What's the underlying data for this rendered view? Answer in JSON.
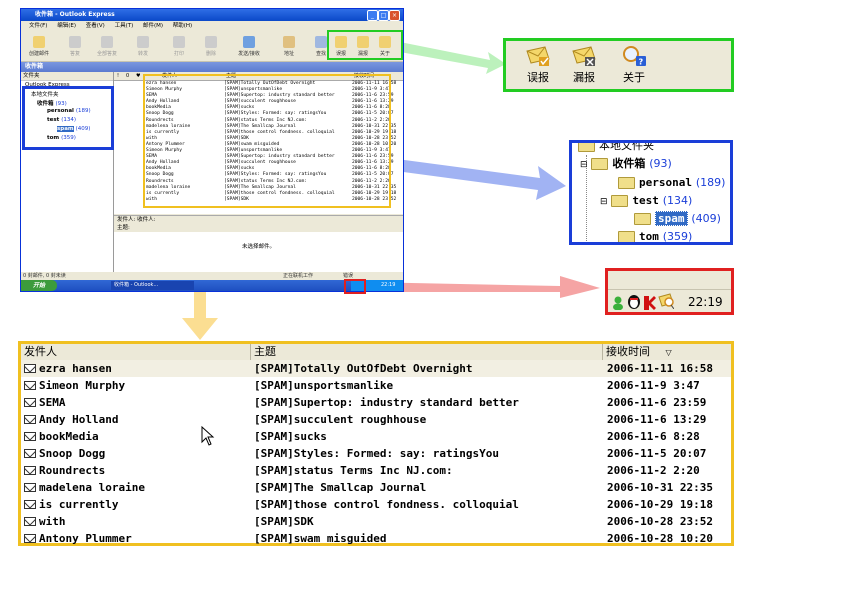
{
  "window": {
    "title": "收件箱 - Outlook Express",
    "menu": [
      "文件(F)",
      "编辑(E)",
      "查看(V)",
      "工具(T)",
      "邮件(M)",
      "帮助(H)"
    ],
    "toolbar": [
      "创建邮件",
      "答复",
      "全部答复",
      "转发",
      "打印",
      "删除",
      "发送/接收",
      "地址",
      "查找",
      "误报",
      "漏报",
      "关于"
    ],
    "folder_header": "收件箱",
    "tree_header": "文件夹",
    "tree": [
      {
        "label": "Outlook Express",
        "count": ""
      },
      {
        "label": "本地文件夹",
        "count": ""
      },
      {
        "label": "收件箱",
        "count": "(93)"
      },
      {
        "label": "personal",
        "count": "(189)"
      },
      {
        "label": "test",
        "count": "(134)"
      },
      {
        "label": "spam",
        "count": "(409)"
      },
      {
        "label": "tom",
        "count": "(359)"
      }
    ],
    "list_headers": [
      "!",
      "0",
      "♥",
      "发件人",
      "主题",
      "接收时间"
    ],
    "preview_from_label": "发件人:",
    "preview_subject_label": "主题:",
    "preview_to_label": "收件人:",
    "preview_empty": "未选择邮件。",
    "status_left": "0 封邮件, 0 封未读",
    "status_mid": "正在联机工作",
    "status_right": "错误",
    "start": "开始",
    "task": "收件箱 - Outlook...",
    "tray_time": "22:19"
  },
  "zoom_toolbar": {
    "buttons": [
      {
        "label": "误报",
        "icon": "envelope-check-icon"
      },
      {
        "label": "漏报",
        "icon": "envelope-x-icon"
      },
      {
        "label": "关于",
        "icon": "magnifier-help-icon"
      }
    ]
  },
  "zoom_tree": {
    "root": "本地文件夹",
    "items": [
      {
        "label": "收件箱",
        "count": "(93)"
      },
      {
        "label": "personal",
        "count": "(189)"
      },
      {
        "label": "test",
        "count": "(134)"
      },
      {
        "label": "spam",
        "count": "(409)"
      },
      {
        "label": "tom",
        "count": "(359)"
      }
    ]
  },
  "zoom_tray": {
    "time": "22:19"
  },
  "messages": {
    "headers": {
      "from": "发件人",
      "subject": "主题",
      "received": "接收时间"
    },
    "rows": [
      {
        "from": "ezra hansen",
        "subject": "[SPAM]Totally OutOfDebt Overnight",
        "received": "2006-11-11 16:58"
      },
      {
        "from": "Simeon Murphy",
        "subject": "[SPAM]unsportsmanlike",
        "received": "2006-11-9 3:47"
      },
      {
        "from": "SEMA",
        "subject": "[SPAM]Supertop: industry standard better",
        "received": "2006-11-6 23:59"
      },
      {
        "from": "Andy Holland",
        "subject": "[SPAM]succulent roughhouse",
        "received": "2006-11-6 13:29"
      },
      {
        "from": "bookMedia",
        "subject": "[SPAM]sucks",
        "received": "2006-11-6 8:28"
      },
      {
        "from": "Snoop Dogg",
        "subject": "[SPAM]Styles: Formed: say: ratingsYou",
        "received": "2006-11-5 20:07"
      },
      {
        "from": "Roundrects",
        "subject": "[SPAM]status Terms Inc NJ.com:",
        "received": "2006-11-2 2:20"
      },
      {
        "from": "madelena loraine",
        "subject": "[SPAM]The Smallcap Journal",
        "received": "2006-10-31 22:35"
      },
      {
        "from": "is currently",
        "subject": "[SPAM]those control fondness. colloquial",
        "received": "2006-10-29 19:18"
      },
      {
        "from": "with",
        "subject": "[SPAM]SDK",
        "received": "2006-10-28 23:52"
      },
      {
        "from": "Antony Plummer",
        "subject": "[SPAM]swam misguided",
        "received": "2006-10-28 10:20"
      }
    ],
    "mini_extra": [
      {
        "from": "Simeon Murphy",
        "subject": "[SPAM]unsportsmanlike",
        "received": "2006-11-9 3:47"
      },
      {
        "from": "SEMA",
        "subject": "[SPAM]Supertop: industry standard better",
        "received": "2006-11-6 23:59"
      },
      {
        "from": "Andy Holland",
        "subject": "[SPAM]succulent roughhouse",
        "received": "2006-11-6 13:29"
      },
      {
        "from": "bookMedia",
        "subject": "[SPAM]sucks",
        "received": "2006-11-6 8:28"
      },
      {
        "from": "Snoop Dogg",
        "subject": "[SPAM]Styles: Formed: say: ratingsYou",
        "received": "2006-11-5 20:07"
      },
      {
        "from": "Roundrects",
        "subject": "[SPAM]status Terms Inc NJ.com:",
        "received": "2006-11-2 2:20"
      },
      {
        "from": "madelena loraine",
        "subject": "[SPAM]The Smallcap Journal",
        "received": "2006-10-31 22:35"
      },
      {
        "from": "is currently",
        "subject": "[SPAM]those control fondness. colloquial",
        "received": "2006-10-29 19:18"
      },
      {
        "from": "with",
        "subject": "[SPAM]SDK",
        "received": "2006-10-28 23:52"
      }
    ]
  },
  "colors": {
    "green": "#22cc22",
    "blue": "#1a3ed8",
    "red": "#e02020",
    "yellow": "#f0c020"
  }
}
